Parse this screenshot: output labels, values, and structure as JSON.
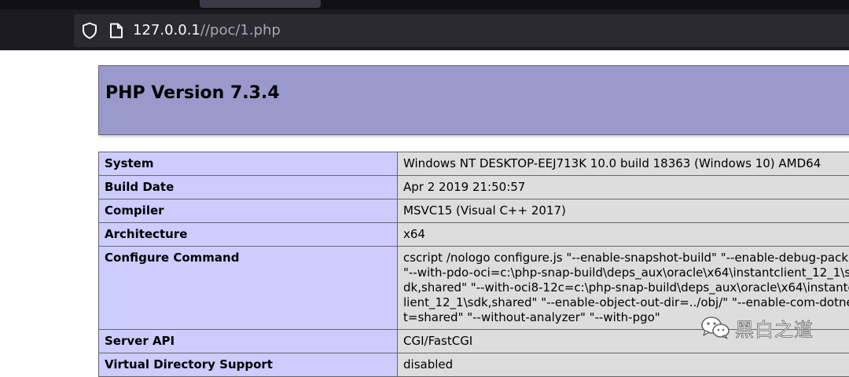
{
  "browser": {
    "url_host": "127.0.0.1",
    "url_path": "//poc/1.php",
    "icons": {
      "shield": "shield-icon",
      "page": "page-icon"
    }
  },
  "page": {
    "title": "PHP Version 7.3.4",
    "rows": [
      {
        "label": "System",
        "value": "Windows NT DESKTOP-EEJ713K 10.0 build 18363 (Windows 10) AMD64"
      },
      {
        "label": "Build Date",
        "value": "Apr 2 2019 21:50:57"
      },
      {
        "label": "Compiler",
        "value": "MSVC15 (Visual C++ 2017)"
      },
      {
        "label": "Architecture",
        "value": "x64"
      },
      {
        "label": "Configure Command",
        "value": "cscript /nologo configure.js \"--enable-snapshot-build\" \"--enable-debug-pack\" \"--with-pdo-oci=c:\\php-snap-build\\deps_aux\\oracle\\x64\\instantclient_12_1\\sdk,shared\" \"--with-oci8-12c=c:\\php-snap-build\\deps_aux\\oracle\\x64\\instantclient_12_1\\sdk,shared\" \"--enable-object-out-dir=../obj/\" \"--enable-com-dotnet=shared\" \"--without-analyzer\" \"--with-pgo\""
      },
      {
        "label": "Server API",
        "value": "CGI/FastCGI"
      },
      {
        "label": "Virtual Directory Support",
        "value": "disabled"
      }
    ]
  },
  "watermark": {
    "text": "黑白之道",
    "icon": "wechat-icon"
  },
  "colors": {
    "header_bg": "#9999cc",
    "label_bg": "#ccccff",
    "value_bg": "#dddddd",
    "browser_bg": "#1c1b22"
  }
}
